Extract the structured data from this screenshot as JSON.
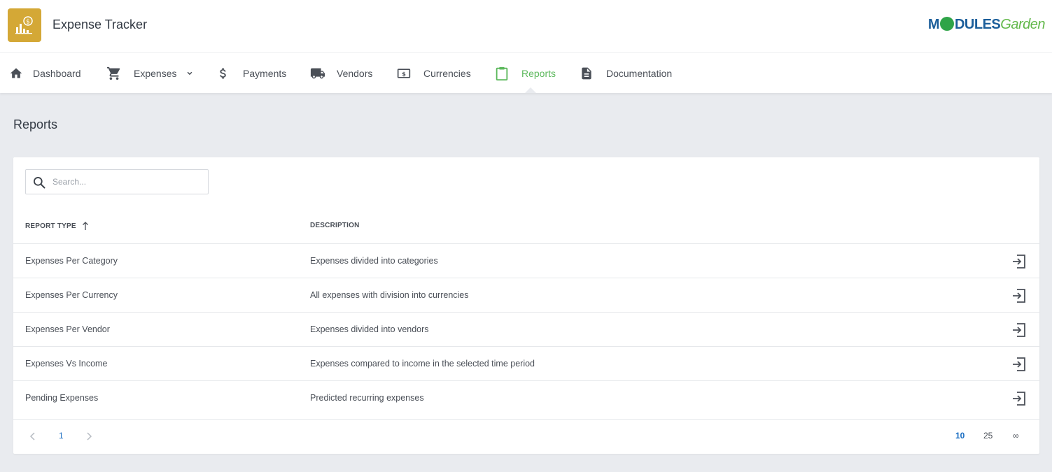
{
  "app": {
    "title": "Expense Tracker",
    "brand_part1": "M",
    "brand_part2": "DULES",
    "brand_part3": "Garden"
  },
  "nav": {
    "items": [
      {
        "label": "Dashboard",
        "icon": "home-icon"
      },
      {
        "label": "Expenses",
        "icon": "cart-icon",
        "has_dropdown": true
      },
      {
        "label": "Payments",
        "icon": "dollar-icon"
      },
      {
        "label": "Vendors",
        "icon": "truck-icon"
      },
      {
        "label": "Currencies",
        "icon": "money-icon"
      },
      {
        "label": "Reports",
        "icon": "clipboard-icon",
        "active": true
      },
      {
        "label": "Documentation",
        "icon": "document-icon"
      }
    ]
  },
  "page": {
    "title": "Reports"
  },
  "search": {
    "placeholder": "Search..."
  },
  "table": {
    "columns": [
      {
        "label": "REPORT TYPE",
        "sort": "ascending"
      },
      {
        "label": "DESCRIPTION"
      }
    ],
    "rows": [
      {
        "type": "Expenses Per Category",
        "description": "Expenses divided into categories"
      },
      {
        "type": "Expenses Per Currency",
        "description": "All expenses with division into currencies"
      },
      {
        "type": "Expenses Per Vendor",
        "description": "Expenses divided into vendors"
      },
      {
        "type": "Expenses Vs Income",
        "description": "Expenses compared to income in the selected time period"
      },
      {
        "type": "Pending Expenses",
        "description": "Predicted recurring expenses"
      }
    ]
  },
  "pagination": {
    "current_page": "1",
    "per_page_options": [
      "10",
      "25",
      "∞"
    ],
    "selected_per_page": "10"
  },
  "colors": {
    "accent": "#5cb85c",
    "brand_blue": "#1b5e9a",
    "logo_gold": "#d4a836",
    "link_blue": "#1b6ec2"
  }
}
